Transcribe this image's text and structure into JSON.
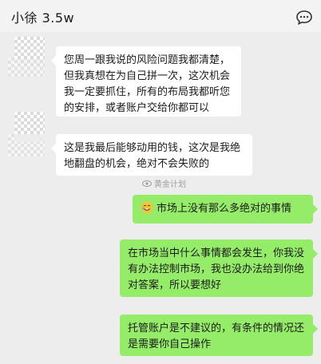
{
  "header": {
    "title": "小徐  3.5w",
    "more_icon": "chat-bubble-more-icon"
  },
  "messages": [
    {
      "side": "left",
      "text": "您周一跟我说的风险问题我都清楚，但我真想在为自己拼一次，这次机会我一定要抓住，所有的布局我都听您的安排，或者账户交给你都可以"
    },
    {
      "side": "left",
      "text": "这是我最后能够动用的钱，这次是我绝地翻盘的机会，绝对不会失败的"
    },
    {
      "side": "right",
      "emoji": "face-emoji-icon",
      "text": "市场上没有那么多绝对的事情"
    },
    {
      "side": "right",
      "text": "在市场当中什么事情都会发生，你我没有办法控制市场，我也没办法给到你绝对答案，所以要想好"
    },
    {
      "side": "right",
      "text": "托管账户是不建议的，有条件的情况还是需要你自己操作"
    }
  ],
  "watermark": {
    "text": "黄金计划"
  },
  "colors": {
    "background": "#ededed",
    "left_bubble": "#ffffff",
    "right_bubble": "#95ec69"
  }
}
